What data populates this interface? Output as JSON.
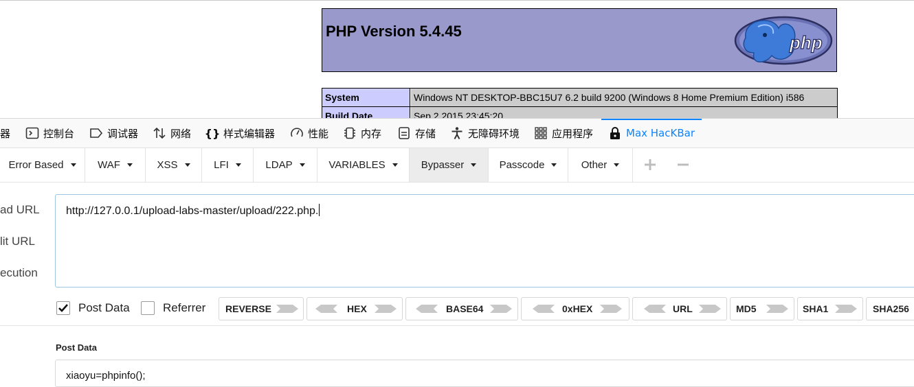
{
  "php_info": {
    "title": "PHP Version 5.4.45",
    "logo_text": "php",
    "rows": [
      {
        "key": "System",
        "value": "Windows NT DESKTOP-BBC15U7 6.2 build 9200 (Windows 8 Home Premium Edition) i586"
      },
      {
        "key": "Build Date",
        "value": "Sep 2 2015 23:45:20"
      }
    ]
  },
  "devtools": {
    "tabs": [
      {
        "label": "器",
        "icon": "inspector-icon"
      },
      {
        "label": "控制台",
        "icon": "console-icon"
      },
      {
        "label": "调试器",
        "icon": "debugger-icon"
      },
      {
        "label": "网络",
        "icon": "network-icon"
      },
      {
        "label": "样式编辑器",
        "icon": "style-editor-icon"
      },
      {
        "label": "性能",
        "icon": "performance-icon"
      },
      {
        "label": "内存",
        "icon": "memory-icon"
      },
      {
        "label": "存储",
        "icon": "storage-icon"
      },
      {
        "label": "无障碍环境",
        "icon": "accessibility-icon"
      },
      {
        "label": "应用程序",
        "icon": "application-icon"
      },
      {
        "label": "Max HacKBar",
        "icon": "hackbar-icon",
        "active": true
      }
    ],
    "accent_color": "#0a84ff"
  },
  "hackbar": {
    "menu": [
      "Error Based",
      "WAF",
      "XSS",
      "LFI",
      "LDAP",
      "VARIABLES",
      "Bypasser",
      "Passcode",
      "Other"
    ],
    "side_labels": [
      "ad URL",
      "lit URL",
      "ecution"
    ],
    "url_value": "http://127.0.0.1/upload-labs-master/upload/222.php.",
    "options": {
      "post_data_label": "Post Data",
      "post_data_checked": true,
      "referrer_label": "Referrer",
      "referrer_checked": false
    },
    "encoders": [
      "REVERSE",
      "HEX",
      "BASE64",
      "0xHEX",
      "URL",
      "MD5",
      "SHA1",
      "SHA256"
    ],
    "post_section_title": "Post Data",
    "post_value": "xiaoyu=phpinfo();"
  }
}
